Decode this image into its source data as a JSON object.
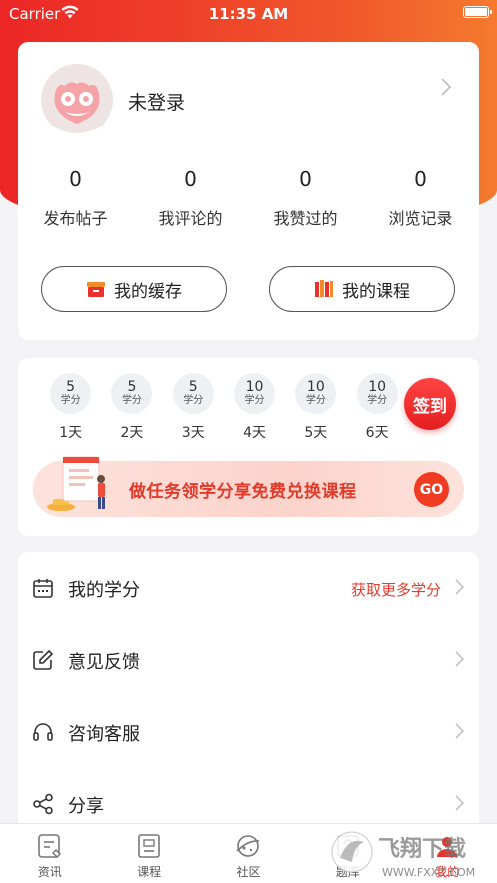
{
  "status_bar": {
    "carrier": "Carrier",
    "time": "11:35 AM"
  },
  "profile": {
    "username": "未登录",
    "stats": [
      {
        "value": "0",
        "label": "发布帖子"
      },
      {
        "value": "0",
        "label": "我评论的"
      },
      {
        "value": "0",
        "label": "我赞过的"
      },
      {
        "value": "0",
        "label": "浏览记录"
      }
    ],
    "buttons": {
      "cache": "我的缓存",
      "courses": "我的课程"
    }
  },
  "checkin": {
    "days": [
      {
        "points": "5",
        "unit": "学分",
        "day": "1天"
      },
      {
        "points": "5",
        "unit": "学分",
        "day": "2天"
      },
      {
        "points": "5",
        "unit": "学分",
        "day": "3天"
      },
      {
        "points": "10",
        "unit": "学分",
        "day": "4天"
      },
      {
        "points": "10",
        "unit": "学分",
        "day": "5天"
      },
      {
        "points": "10",
        "unit": "学分",
        "day": "6天"
      }
    ],
    "sign_label": "签到",
    "banner_text": "做任务领学分享免费兑换课程",
    "banner_go": "GO"
  },
  "menu": {
    "items": [
      {
        "icon": "calendar-icon",
        "label": "我的学分",
        "extra": "获取更多学分"
      },
      {
        "icon": "edit-icon",
        "label": "意见反馈",
        "extra": ""
      },
      {
        "icon": "headset-icon",
        "label": "咨询客服",
        "extra": ""
      },
      {
        "icon": "share-icon",
        "label": "分享",
        "extra": ""
      }
    ]
  },
  "tabbar": {
    "tabs": [
      {
        "icon": "news-icon",
        "label": "资讯"
      },
      {
        "icon": "course-icon",
        "label": "课程"
      },
      {
        "icon": "community-icon",
        "label": "社区"
      },
      {
        "icon": "question-bank-icon",
        "label": "题库"
      },
      {
        "icon": "profile-icon",
        "label": "我的"
      }
    ],
    "active_index": 4
  },
  "watermark": {
    "text_cn": "飞翔下载",
    "text_en": "WWW.FXXZ.COM"
  },
  "colors": {
    "accent": "#e8322b",
    "hero_start": "#ec2626",
    "hero_end": "#f57a2e"
  }
}
